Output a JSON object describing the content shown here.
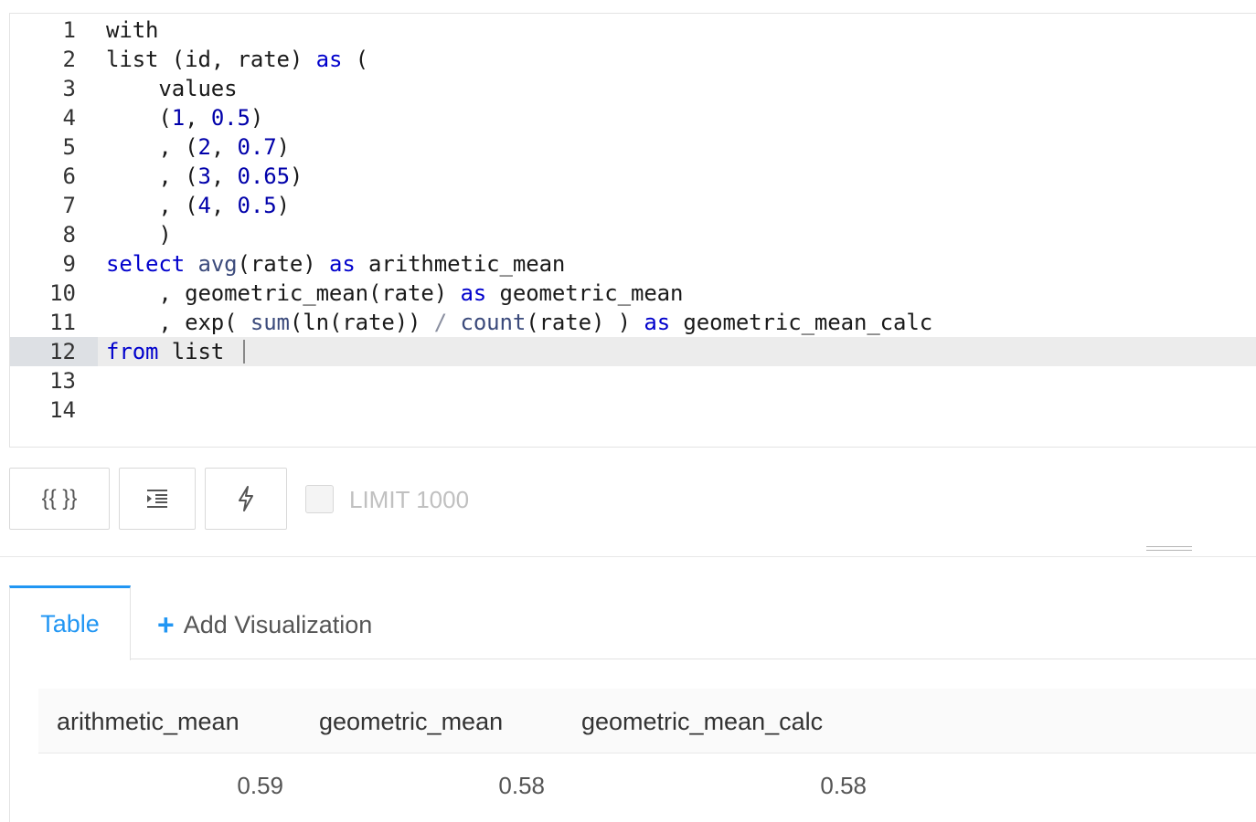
{
  "editor": {
    "lines": [
      {
        "num": "1"
      },
      {
        "num": "2"
      },
      {
        "num": "3"
      },
      {
        "num": "4"
      },
      {
        "num": "5"
      },
      {
        "num": "6"
      },
      {
        "num": "7"
      },
      {
        "num": "8"
      },
      {
        "num": "9"
      },
      {
        "num": "10"
      },
      {
        "num": "11"
      },
      {
        "num": "12"
      },
      {
        "num": "13"
      },
      {
        "num": "14"
      }
    ],
    "active_line": "12",
    "tokens": {
      "l1": [
        "with"
      ],
      "l2": [
        "list (id, rate) ",
        "as",
        " ("
      ],
      "l3": [
        "    values"
      ],
      "l4": [
        "    (",
        "1",
        ", ",
        "0.5",
        ")"
      ],
      "l5": [
        "    , (",
        "2",
        ", ",
        "0.7",
        ")"
      ],
      "l6": [
        "    , (",
        "3",
        ", ",
        "0.65",
        ")"
      ],
      "l7": [
        "    , (",
        "4",
        ", ",
        "0.5",
        ")"
      ],
      "l8": [
        "    )"
      ],
      "l9": [
        "select",
        " ",
        "avg",
        "(rate) ",
        "as",
        " arithmetic_mean"
      ],
      "l10": [
        "    , geometric_mean(rate) ",
        "as",
        " geometric_mean"
      ],
      "l11": [
        "    , exp( ",
        "sum",
        "(ln(rate)) ",
        "/",
        " ",
        "count",
        "(rate) ) ",
        "as",
        " geometric_mean_calc"
      ],
      "l12": [
        "from",
        " list "
      ]
    }
  },
  "toolbar": {
    "params_label": "{{ }}",
    "format_icon": "indent-icon",
    "autocomplete_icon": "lightning-icon",
    "limit_label": "LIMIT 1000",
    "limit_checked": false
  },
  "tabs": {
    "table_label": "Table",
    "add_visualization_label": "Add Visualization"
  },
  "results": {
    "columns": [
      "arithmetic_mean",
      "geometric_mean",
      "geometric_mean_calc"
    ],
    "rows": [
      [
        "0.59",
        "0.58",
        "0.58"
      ]
    ]
  },
  "colors": {
    "accent": "#2196f3",
    "keyword": "#0000cc",
    "number": "#0000aa",
    "function": "#3c4b7c"
  }
}
